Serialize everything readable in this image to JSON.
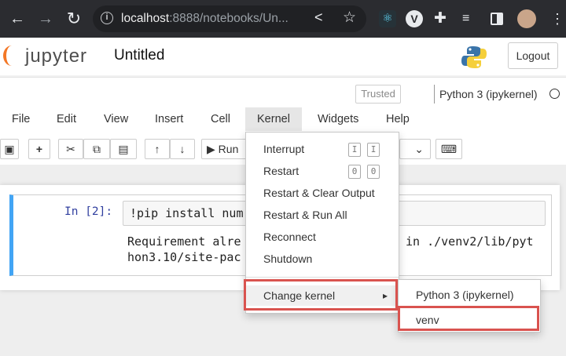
{
  "browser": {
    "url_host": "localhost",
    "url_rest": ":8888/notebooks/Un...",
    "icons": [
      "back-arrow-icon",
      "forward-arrow-icon",
      "reload-icon",
      "site-info-icon",
      "share-icon",
      "bookmark-star-icon",
      "react-devtools-icon",
      "extension-v-icon",
      "extensions-puzzle-icon",
      "media-control-icon",
      "side-panel-icon",
      "profile-avatar",
      "menu-kebab-icon"
    ]
  },
  "header": {
    "logo_text": "jupyter",
    "notebook_title": "Untitled",
    "logout_label": "Logout"
  },
  "status": {
    "trusted_label": "Trusted",
    "kernel_name": "Python 3 (ipykernel)"
  },
  "menu": {
    "items": [
      "File",
      "Edit",
      "View",
      "Insert",
      "Cell",
      "Kernel",
      "Widgets",
      "Help"
    ],
    "open_item": "Kernel"
  },
  "toolbar": {
    "run_label": "Run"
  },
  "cell": {
    "prompt": "In [2]:",
    "code": "!pip install num",
    "output_line1": "Requirement alre",
    "output_line1_tail": "in ./venv2/lib/pyt",
    "output_line2": "hon3.10/site-pac"
  },
  "kernel_menu": {
    "interrupt": "Interrupt",
    "interrupt_key": "I",
    "restart": "Restart",
    "restart_key": "0",
    "restart_clear": "Restart & Clear Output",
    "restart_run": "Restart & Run All",
    "reconnect": "Reconnect",
    "shutdown": "Shutdown",
    "change_kernel": "Change kernel",
    "submenu_arrow": "▸"
  },
  "change_kernel_submenu": {
    "items": [
      "Python 3 (ipykernel)",
      "venv"
    ]
  },
  "colors": {
    "highlight_box": "#d9534f",
    "cell_selected_border": "#42a5f5",
    "jupyter_orange": "#f37726"
  }
}
